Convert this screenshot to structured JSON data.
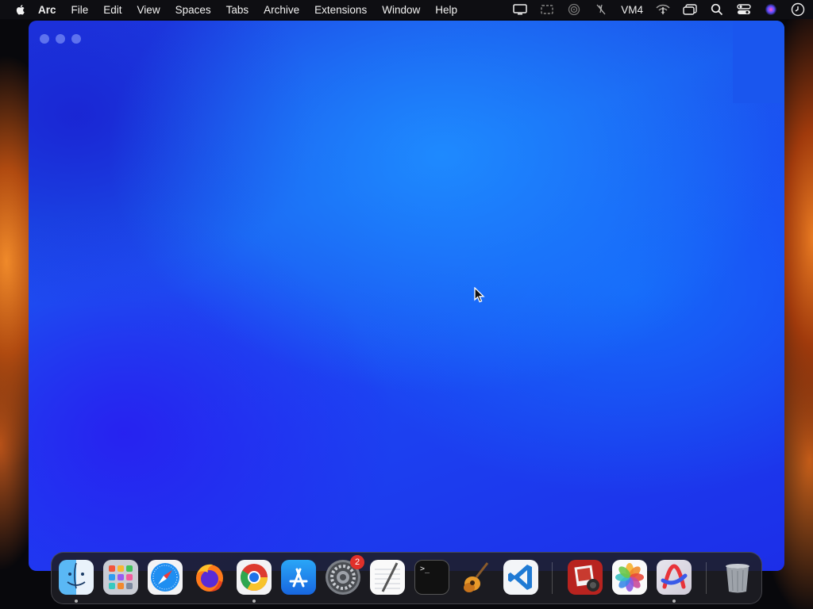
{
  "menubar": {
    "apple_icon": "apple-icon",
    "app_name": "Arc",
    "items": [
      "File",
      "Edit",
      "View",
      "Spaces",
      "Tabs",
      "Archive",
      "Extensions",
      "Window",
      "Help"
    ],
    "status_label": "VM4",
    "status_icons": [
      "display-icon",
      "screen-mirror-icon",
      "airdrop-icon",
      "mic-off-icon",
      "wifi-icon",
      "window-switch-icon",
      "search-icon",
      "control-center-icon",
      "siri-icon",
      "clock-icon"
    ]
  },
  "window": {
    "app": "Arc",
    "background_colors": [
      "#1e3adf",
      "#1a5cf0",
      "#1c44f2"
    ]
  },
  "dock": {
    "items": [
      {
        "name": "finder",
        "icon": "finder-icon",
        "running": true
      },
      {
        "name": "launchpad",
        "icon": "launchpad-icon",
        "running": false
      },
      {
        "name": "safari",
        "icon": "safari-icon",
        "running": false
      },
      {
        "name": "firefox",
        "icon": "firefox-icon",
        "running": false
      },
      {
        "name": "chrome",
        "icon": "chrome-icon",
        "running": true
      },
      {
        "name": "app-store",
        "icon": "app-store-icon",
        "running": false
      },
      {
        "name": "system-settings",
        "icon": "settings-gear-icon",
        "running": false,
        "badge": "2"
      },
      {
        "name": "textedit",
        "icon": "textedit-icon",
        "running": false
      },
      {
        "name": "terminal",
        "icon": "terminal-icon",
        "running": false,
        "prompt": ">_"
      },
      {
        "name": "garageband",
        "icon": "guitar-icon",
        "running": false
      },
      {
        "name": "vscode",
        "icon": "vscode-icon",
        "running": false
      },
      {
        "name": "photo-booth",
        "icon": "photo-booth-icon",
        "running": false
      },
      {
        "name": "photos",
        "icon": "photos-icon",
        "running": false
      },
      {
        "name": "arc-browser",
        "icon": "arc-icon",
        "running": true
      },
      {
        "name": "trash",
        "icon": "trash-icon",
        "running": false
      }
    ]
  }
}
